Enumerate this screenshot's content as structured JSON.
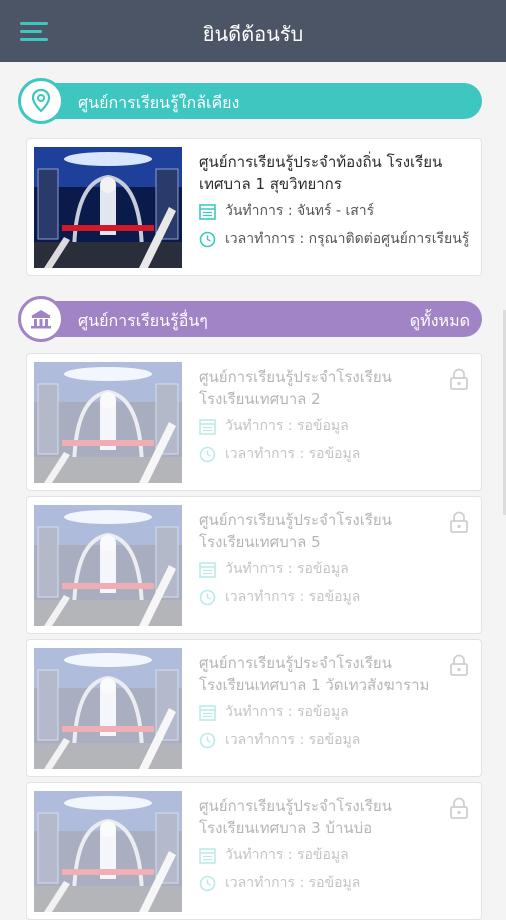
{
  "header": {
    "title": "ยินดีต้อนรับ",
    "menu_icon": "hamburger-icon"
  },
  "colors": {
    "header_bg": "#4c5566",
    "accent_teal": "#3ec7c1",
    "accent_purple": "#a184c6"
  },
  "nearby_section": {
    "title": "ศูนย์การเรียนรู้ใกล้เคียง",
    "icon": "location-pin-icon"
  },
  "nearby_card": {
    "title_line1": "ศูนย์การเรียนรู้ประจำท้องถิ่น โรงเรียน",
    "title_line2": "เทศบาล 1 สุขวิทยากร",
    "days": "วันทำการ : จันทร์ - เสาร์",
    "hours": "เวลาทำการ : กรุณาติดต่อศูนย์การเรียนรู้"
  },
  "other_section": {
    "title": "ศูนย์การเรียนรู้อื่นๆ",
    "see_all": "ดูทั้งหมด",
    "icon": "school-building-icon"
  },
  "other_cards": [
    {
      "title_line1": "ศูนย์การเรียนรู้ประจำโรงเรียน",
      "title_line2": "โรงเรียนเทศบาล 2",
      "days": "วันทำการ : รอข้อมูล",
      "hours": "เวลาทำการ : รอข้อมูล"
    },
    {
      "title_line1": "ศูนย์การเรียนรู้ประจำโรงเรียน",
      "title_line2": "โรงเรียนเทศบาล 5",
      "days": "วันทำการ : รอข้อมูล",
      "hours": "เวลาทำการ : รอข้อมูล"
    },
    {
      "title_line1": "ศูนย์การเรียนรู้ประจำโรงเรียน",
      "title_line2": "โรงเรียนเทศบาล 1 วัดเทวสังฆาราม",
      "days": "วันทำการ : รอข้อมูล",
      "hours": "เวลาทำการ : รอข้อมูล"
    },
    {
      "title_line1": "ศูนย์การเรียนรู้ประจำโรงเรียน",
      "title_line2": "โรงเรียนเทศบาล 3 บ้านบ่อ",
      "days": "วันทำการ : รอข้อมูล",
      "hours": "เวลาทำการ : รอข้อมูล"
    }
  ]
}
